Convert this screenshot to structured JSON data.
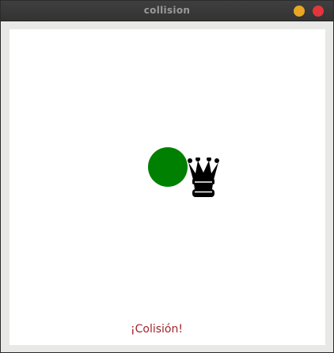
{
  "window": {
    "title": "collision",
    "minimize_color": "#e9a623",
    "close_color": "#e2363d"
  },
  "scene": {
    "circle_color": "#008000",
    "sprite_icon": "black-queen-icon",
    "sprite_color": "#000000"
  },
  "status": {
    "text": "¡Colisión!",
    "color": "#a0252a"
  }
}
